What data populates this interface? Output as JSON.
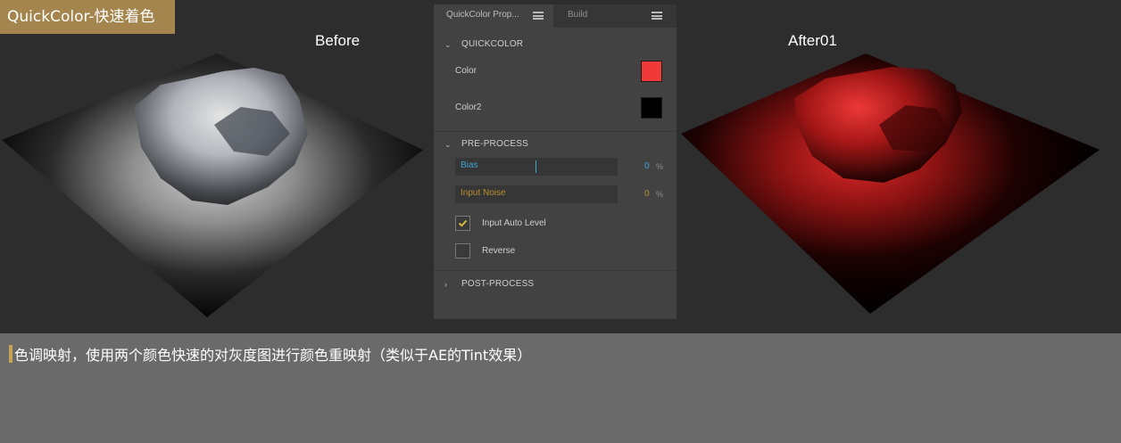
{
  "badge": {
    "title": "QuickColor-快速着色"
  },
  "views": {
    "before_label": "Before",
    "after_label": "After01"
  },
  "panel": {
    "tabs": [
      {
        "label": "QuickColor Prop..."
      },
      {
        "label": "Build"
      }
    ],
    "quickcolor": {
      "header": "QUICKCOLOR",
      "color_label": "Color",
      "color_value": "#f03a3a",
      "color2_label": "Color2",
      "color2_value": "#000000"
    },
    "preprocess": {
      "header": "PRE-PROCESS",
      "bias_label": "Bias",
      "bias_value": "0",
      "bias_unit": "%",
      "noise_label": "Input Noise",
      "noise_value": "0",
      "noise_unit": "%",
      "auto_level_label": "Input Auto Level",
      "auto_level_checked": true,
      "reverse_label": "Reverse",
      "reverse_checked": false
    },
    "postprocess": {
      "header": "POST-PROCESS"
    }
  },
  "caption": {
    "text": "色调映射，使用两个颜色快速的对灰度图进行颜色重映射（类似于AE的Tint效果）"
  },
  "colors": {
    "accent_gold": "#a4854e",
    "bias_blue": "#3fa6d2",
    "noise_amber": "#b8902e",
    "check_yellow": "#e2c23a"
  }
}
